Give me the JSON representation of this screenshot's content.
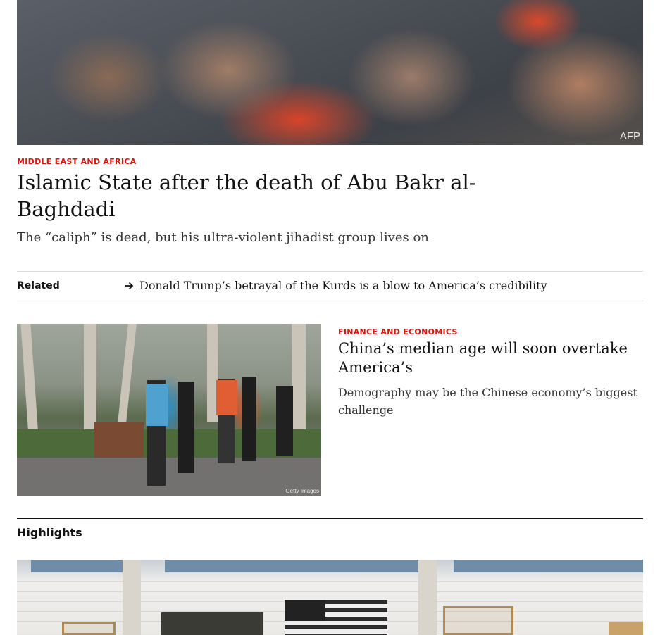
{
  "top_story": {
    "image_credit": "AFP",
    "kicker": "Middle East and Africa",
    "headline_line1": "Islamic State after the death of Abu Bakr al-",
    "headline_line2": "Baghdadi",
    "rubric": "The “caliph” is dead, but his ultra-violent jihadist group lives on"
  },
  "related": {
    "label": "Related",
    "link": "Donald Trump’s betrayal of the Kurds is a blow to America’s credibility"
  },
  "story2": {
    "image_credit": "Getty Images",
    "kicker": "Finance and economics",
    "headline_line1": "China’s median age will soon overtake",
    "headline_line2": "America’s",
    "rubric_line1": "Demography may be the Chinese economy’s biggest",
    "rubric_line2": "challenge"
  },
  "highlights": {
    "title": "Highlights"
  },
  "colors": {
    "kicker_red": "#e3120b",
    "text": "#121212",
    "rule": "#d8d8d8"
  }
}
